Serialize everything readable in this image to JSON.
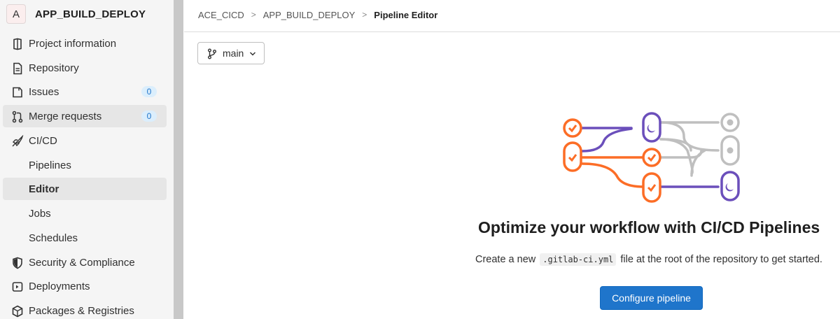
{
  "project": {
    "avatar_letter": "A",
    "name": "APP_BUILD_DEPLOY"
  },
  "sidebar": {
    "items": [
      {
        "label": "Project information",
        "icon": "project-info-icon"
      },
      {
        "label": "Repository",
        "icon": "document-icon"
      },
      {
        "label": "Issues",
        "icon": "issues-icon",
        "badge": "0"
      },
      {
        "label": "Merge requests",
        "icon": "merge-request-icon",
        "badge": "0"
      },
      {
        "label": "CI/CD",
        "icon": "rocket-icon"
      },
      {
        "label": "Pipelines"
      },
      {
        "label": "Editor"
      },
      {
        "label": "Jobs"
      },
      {
        "label": "Schedules"
      },
      {
        "label": "Security & Compliance",
        "icon": "shield-icon"
      },
      {
        "label": "Deployments",
        "icon": "deployments-icon"
      },
      {
        "label": "Packages & Registries",
        "icon": "package-icon"
      }
    ]
  },
  "breadcrumb": {
    "items": [
      "ACE_CICD",
      "APP_BUILD_DEPLOY",
      "Pipeline Editor"
    ],
    "separator": ">"
  },
  "branch": {
    "label": "main"
  },
  "empty_state": {
    "title": "Optimize your workflow with CI/CD Pipelines",
    "desc_before": "Create a new",
    "code": ".gitlab-ci.yml",
    "desc_after": "file at the root of the repository to get started.",
    "button_label": "Configure pipeline"
  },
  "colors": {
    "accent": "#1f75cb",
    "orange": "#fc6d26",
    "purple": "#6b4fbb",
    "gray": "#bfbfbf"
  }
}
